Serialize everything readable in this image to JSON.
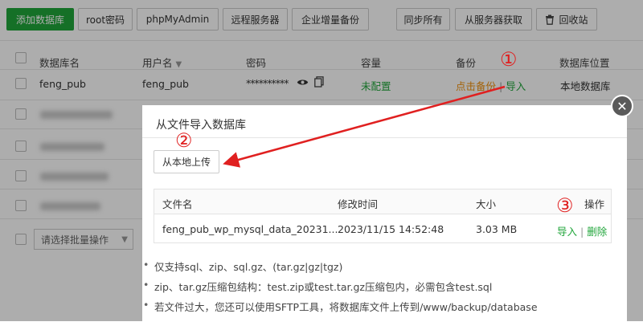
{
  "toolbar": {
    "add_db": "添加数据库",
    "root_pwd": "root密码",
    "phpmyadmin": "phpMyAdmin",
    "remote_server": "远程服务器",
    "incremental_backup": "企业增量备份",
    "sync_all": "同步所有",
    "fetch_from_server": "从服务器获取",
    "recycle_bin": "回收站"
  },
  "table": {
    "headers": [
      "数据库名",
      "用户名",
      "密码",
      "容量",
      "备份",
      "数据库位置"
    ],
    "row": {
      "db_name": "feng_pub",
      "user": "feng_pub",
      "password": "**********",
      "capacity": "未配置",
      "backup_link": "点击备份",
      "separator": "|",
      "import_link": "导入",
      "location": "本地数据库"
    },
    "batch_placeholder": "请选择批量操作"
  },
  "modal": {
    "title": "从文件导入数据库",
    "upload_button": "从本地上传",
    "file_table": {
      "headers": [
        "文件名",
        "修改时间",
        "大小",
        "操作"
      ],
      "rows": [
        {
          "name": "feng_pub_wp_mysql_data_20231...",
          "mtime": "2023/11/15 14:52:48",
          "size": "3.03 MB",
          "import": "导入",
          "sep": "|",
          "delete": "删除"
        }
      ]
    },
    "notes": [
      "仅支持sql、zip、sql.gz、(tar.gz|gz|tgz)",
      "zip、tar.gz压缩包结构：test.zip或test.tar.gz压缩包内，必需包含test.sql",
      "若文件过大，您还可以使用SFTP工具，将数据库文件上传到/www/backup/database"
    ]
  },
  "annotations": {
    "one": "①",
    "two": "②",
    "three": "③"
  },
  "colors": {
    "accent": "#20a53a",
    "annotation": "#e02020",
    "backup_link": "#f0900a"
  },
  "icons": {
    "eye": "eye-icon",
    "copy": "copy-icon",
    "trash": "trash-icon",
    "close": "close-icon",
    "sort": "caret-down-icon"
  }
}
